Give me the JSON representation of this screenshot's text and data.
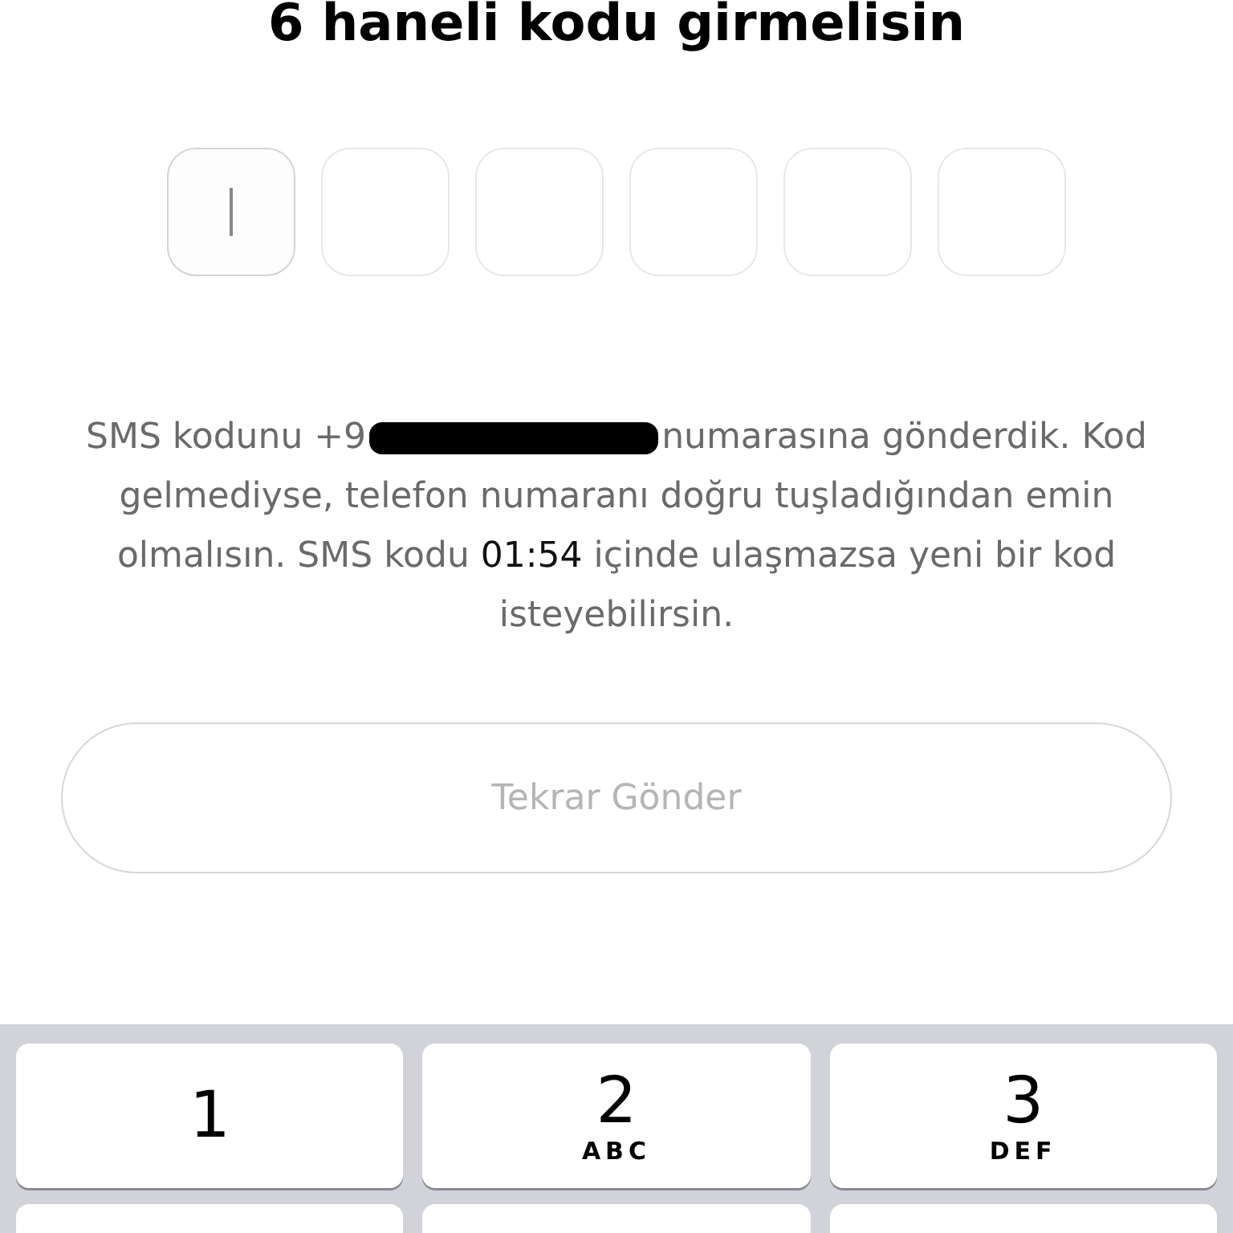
{
  "title": "6 haneli kodu girmelisin",
  "code_boxes": [
    {
      "focused": true
    },
    {
      "focused": false
    },
    {
      "focused": false
    },
    {
      "focused": false
    },
    {
      "focused": false
    },
    {
      "focused": false
    }
  ],
  "sms_note": {
    "before": "SMS kodunu +9",
    "after": "numarasına gönderdik. Kod gelmediyse, telefon numaranı doğru tuşladığından emin olmalısın. SMS kodu **01:54** içinde ulaşmazsa yeni bir kod isteyebilirsin."
  },
  "resend_button": {
    "label": "Tekrar Gönder",
    "disabled": true
  },
  "keypad": [
    {
      "digit": "1"
    },
    {
      "digit": "2",
      "letters": "ABC"
    },
    {
      "digit": "3",
      "letters": "DEF"
    }
  ]
}
